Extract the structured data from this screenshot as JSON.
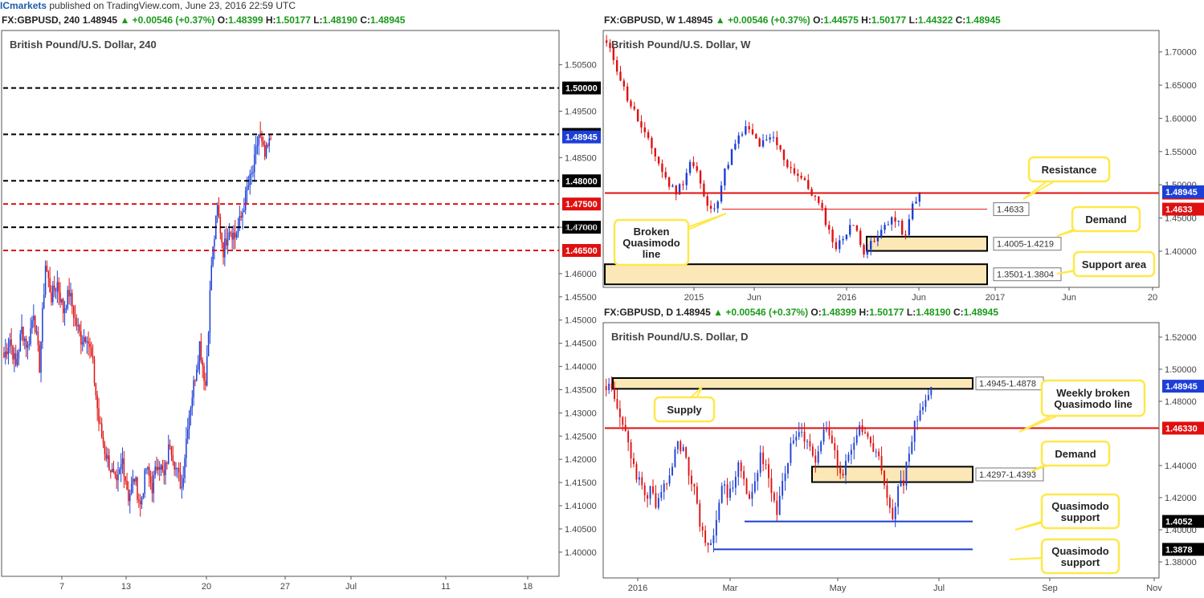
{
  "header": {
    "brand": "ICmarkets",
    "published": "published on TradingView.com, June 23, 2016 22:59 UTC"
  },
  "panels": {
    "h4": {
      "symbol": "FX:GBPUSD, 240",
      "last": "1.48945",
      "change": "+0.00546 (+0.37%)",
      "O": "1.48399",
      "H": "1.50177",
      "L": "1.48190",
      "C": "1.48945",
      "title": "British Pound/U.S. Dollar, 240"
    },
    "weekly": {
      "symbol": "FX:GBPUSD, W",
      "last": "1.48945",
      "change": "+0.00546 (+0.37%)",
      "O": "1.44575",
      "H": "1.50177",
      "L": "1.44322",
      "C": "1.48945",
      "title": "British Pound/U.S. Dollar, W"
    },
    "daily": {
      "symbol": "FX:GBPUSD, D",
      "last": "1.48945",
      "change": "+0.00546 (+0.37%)",
      "O": "1.48399",
      "H": "1.50177",
      "L": "1.48190",
      "C": "1.48945",
      "title": "British Pound/U.S. Dollar, D"
    }
  },
  "colors": {
    "bull": "#1d3fd6",
    "bear": "#e01010",
    "zone_fill": "#fce8b6",
    "label_border": "#ffe84a",
    "dash_black": "#000000",
    "dash_red": "#e01010",
    "line_blue": "#1a3fcf"
  },
  "chart_data": [
    {
      "type": "candlestick",
      "title": "British Pound/U.S. Dollar, 240",
      "ylim": [
        1.396,
        1.511
      ],
      "yticks": [
        "1.50500",
        "1.49500",
        "1.48500",
        "1.47000",
        "1.46000",
        "1.45500",
        "1.45000",
        "1.44500",
        "1.44000",
        "1.43500",
        "1.43000",
        "1.42500",
        "1.42000",
        "1.41500",
        "1.41000",
        "1.40500",
        "1.40000"
      ],
      "xticks": [
        "7",
        "13",
        "20",
        "27",
        "Jul",
        "11",
        "18"
      ],
      "levels": [
        {
          "price": "1.50000",
          "value": 1.5,
          "style": "dashed",
          "color": "black"
        },
        {
          "price": "1.49000",
          "value": 1.49,
          "style": "dashed",
          "color": "black"
        },
        {
          "price": "1.48000",
          "value": 1.48,
          "style": "dashed",
          "color": "black"
        },
        {
          "price": "1.47500",
          "value": 1.475,
          "style": "dashed",
          "color": "red"
        },
        {
          "price": "1.47000",
          "value": 1.47,
          "style": "dashed",
          "color": "black"
        },
        {
          "price": "1.46500",
          "value": 1.465,
          "style": "dashed",
          "color": "red"
        }
      ],
      "last_price": "1.48945",
      "series_path": [
        1.442,
        1.446,
        1.44,
        1.448,
        1.444,
        1.452,
        1.44,
        1.462,
        1.455,
        1.458,
        1.452,
        1.456,
        1.45,
        1.446,
        1.447,
        1.44,
        1.428,
        1.422,
        1.418,
        1.414,
        1.42,
        1.412,
        1.416,
        1.41,
        1.418,
        1.414,
        1.42,
        1.416,
        1.424,
        1.418,
        1.414,
        1.428,
        1.436,
        1.445,
        1.436,
        1.462,
        1.474,
        1.465,
        1.47,
        1.468,
        1.472,
        1.478,
        1.482,
        1.49,
        1.485,
        1.489
      ]
    },
    {
      "type": "candlestick",
      "title": "British Pound/U.S. Dollar, W",
      "ylim": [
        1.348,
        1.725
      ],
      "yticks": [
        "1.70000",
        "1.65000",
        "1.60000",
        "1.55000",
        "1.50000",
        "1.45000",
        "1.40000"
      ],
      "xticks": [
        "2015",
        "Jun",
        "2016",
        "Jun",
        "2017",
        "Jun",
        "20"
      ],
      "levels": [
        {
          "price": "1.48750",
          "value": 1.4875,
          "style": "solid",
          "color": "red",
          "width": 2
        },
        {
          "price": "1.4633",
          "value": 1.4633,
          "style": "solid",
          "color": "red",
          "width": 1
        }
      ],
      "zones": [
        {
          "label": "1.4005-1.4219",
          "low": 1.4005,
          "high": 1.4219
        },
        {
          "label": "1.3501-1.3804",
          "low": 1.3501,
          "high": 1.3804
        }
      ],
      "annotations": [
        "Resistance",
        "Broken Quasimodo line",
        "Demand",
        "Support area"
      ],
      "last_price": "1.48945",
      "series_path": [
        1.712,
        1.69,
        1.66,
        1.63,
        1.61,
        1.585,
        1.565,
        1.545,
        1.52,
        1.5,
        1.49,
        1.505,
        1.535,
        1.52,
        1.48,
        1.46,
        1.48,
        1.52,
        1.55,
        1.57,
        1.585,
        1.575,
        1.56,
        1.565,
        1.57,
        1.55,
        1.53,
        1.52,
        1.51,
        1.495,
        1.48,
        1.46,
        1.43,
        1.405,
        1.42,
        1.44,
        1.43,
        1.4,
        1.41,
        1.42,
        1.44,
        1.45,
        1.44,
        1.42,
        1.47,
        1.489
      ]
    },
    {
      "type": "candlestick",
      "title": "British Pound/U.S. Dollar, D",
      "ylim": [
        1.372,
        1.526
      ],
      "yticks": [
        "1.52000",
        "1.50000",
        "1.48000",
        "1.44000",
        "1.42000",
        "1.40000",
        "1.38000"
      ],
      "xticks": [
        "2016",
        "Mar",
        "May",
        "Jul",
        "Sep",
        "Nov"
      ],
      "levels": [
        {
          "price": "1.46330",
          "value": 1.4633,
          "style": "solid",
          "color": "red",
          "width": 2
        },
        {
          "price": "1.4052",
          "value": 1.4052,
          "style": "solid",
          "color": "blue"
        },
        {
          "price": "1.3878",
          "value": 1.3878,
          "style": "solid",
          "color": "blue"
        }
      ],
      "zones": [
        {
          "label": "1.4945-1.4878",
          "low": 1.4878,
          "high": 1.4945
        },
        {
          "label": "1.4297-1.4393",
          "low": 1.4297,
          "high": 1.4393
        }
      ],
      "annotations": [
        "Supply",
        "Weekly broken Quasimodo line",
        "Demand",
        "Quasimodo support",
        "Quasimodo support"
      ],
      "last_price": "1.48945",
      "series_path": [
        1.49,
        1.485,
        1.475,
        1.465,
        1.455,
        1.44,
        1.43,
        1.42,
        1.425,
        1.415,
        1.42,
        1.43,
        1.44,
        1.455,
        1.45,
        1.435,
        1.425,
        1.405,
        1.392,
        1.388,
        1.41,
        1.43,
        1.42,
        1.425,
        1.44,
        1.43,
        1.42,
        1.43,
        1.445,
        1.44,
        1.42,
        1.41,
        1.43,
        1.445,
        1.455,
        1.46,
        1.455,
        1.45,
        1.445,
        1.455,
        1.465,
        1.455,
        1.44,
        1.435,
        1.445,
        1.455,
        1.465,
        1.46,
        1.45,
        1.445,
        1.44,
        1.42,
        1.41,
        1.425,
        1.43,
        1.45,
        1.465,
        1.475,
        1.48,
        1.489
      ]
    }
  ]
}
